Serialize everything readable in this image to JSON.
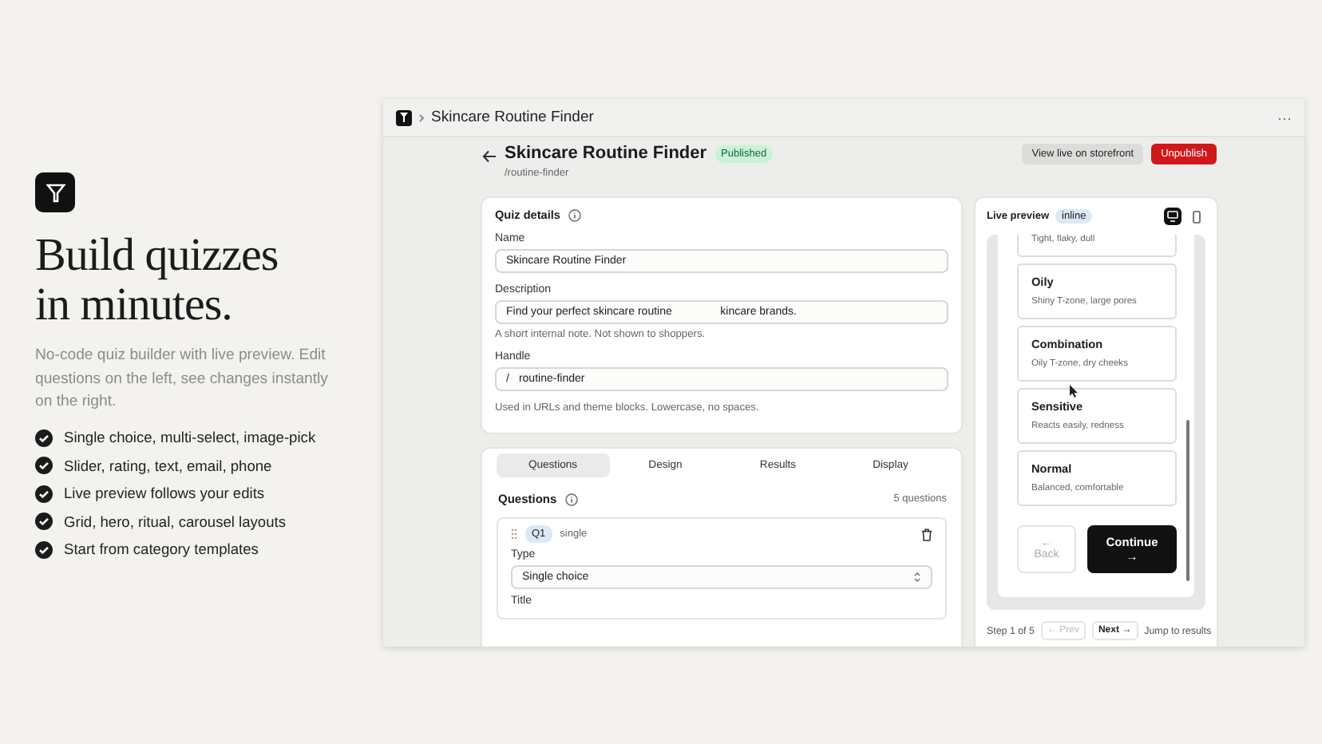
{
  "promo": {
    "headline": [
      "Build quizzes",
      "in minutes."
    ],
    "subtitle": "No-code quiz builder with live preview. Edit questions on the left, see changes instantly on the right.",
    "features": [
      "Single choice, multi-select, image-pick",
      "Slider, rating, text, email, phone",
      "Live preview follows your edits",
      "Grid, hero, ritual, carousel layouts",
      "Start from category templates"
    ]
  },
  "window": {
    "breadcrumb": "Skincare Routine Finder",
    "menu": "···"
  },
  "header": {
    "title": "Skincare Routine Finder",
    "status": "Published",
    "handle": "/routine-finder",
    "buttons": [
      {
        "label": "View live on storefront",
        "kind": "secondary"
      },
      {
        "label": "Unpublish",
        "kind": "danger"
      }
    ]
  },
  "quiz_details": {
    "title": "Quiz details",
    "name": {
      "label": "Name",
      "value": "Skincare Routine Finder"
    },
    "description": {
      "label": "Description",
      "value_parts": [
        "Find your perfect skincare routine",
        "kincare brands."
      ],
      "help": "A short internal note. Not shown to shoppers."
    },
    "handle": {
      "label": "Handle",
      "prefix": "/",
      "value": "routine-finder",
      "help": "Used in URLs and theme blocks. Lowercase, no spaces."
    }
  },
  "tabs": [
    {
      "label": "Questions",
      "selected": true
    },
    {
      "label": "Design",
      "selected": false
    },
    {
      "label": "Results",
      "selected": false
    },
    {
      "label": "Display",
      "selected": false
    }
  ],
  "questions": {
    "title": "Questions",
    "count": "5 questions",
    "items": [
      {
        "number": "Q1",
        "type_tag": "single",
        "type_label": "Type",
        "type_value": "Single choice",
        "next_label": "Title"
      }
    ]
  },
  "preview": {
    "title": "Live preview",
    "mode": "inline",
    "devices": [
      {
        "kind": "desktop",
        "selected": true
      },
      {
        "kind": "mobile",
        "selected": false
      }
    ],
    "options": [
      {
        "description": "Tight, flaky, dull"
      },
      {
        "title": "Oily",
        "description": "Shiny T-zone, large pores"
      },
      {
        "title": "Combination",
        "description": "Oily T-zone, dry cheeks"
      },
      {
        "title": "Sensitive",
        "description": "Reacts easily, redness"
      },
      {
        "title": "Normal",
        "description": "Balanced, comfortable"
      }
    ],
    "back": {
      "arrow": "←",
      "label": "Back"
    },
    "continue": {
      "label": "Continue",
      "arrow": "→"
    },
    "footer": {
      "step": "Step 1 of 5",
      "prev": "← Prev",
      "next": "Next →",
      "jump": "Jump to results"
    }
  }
}
